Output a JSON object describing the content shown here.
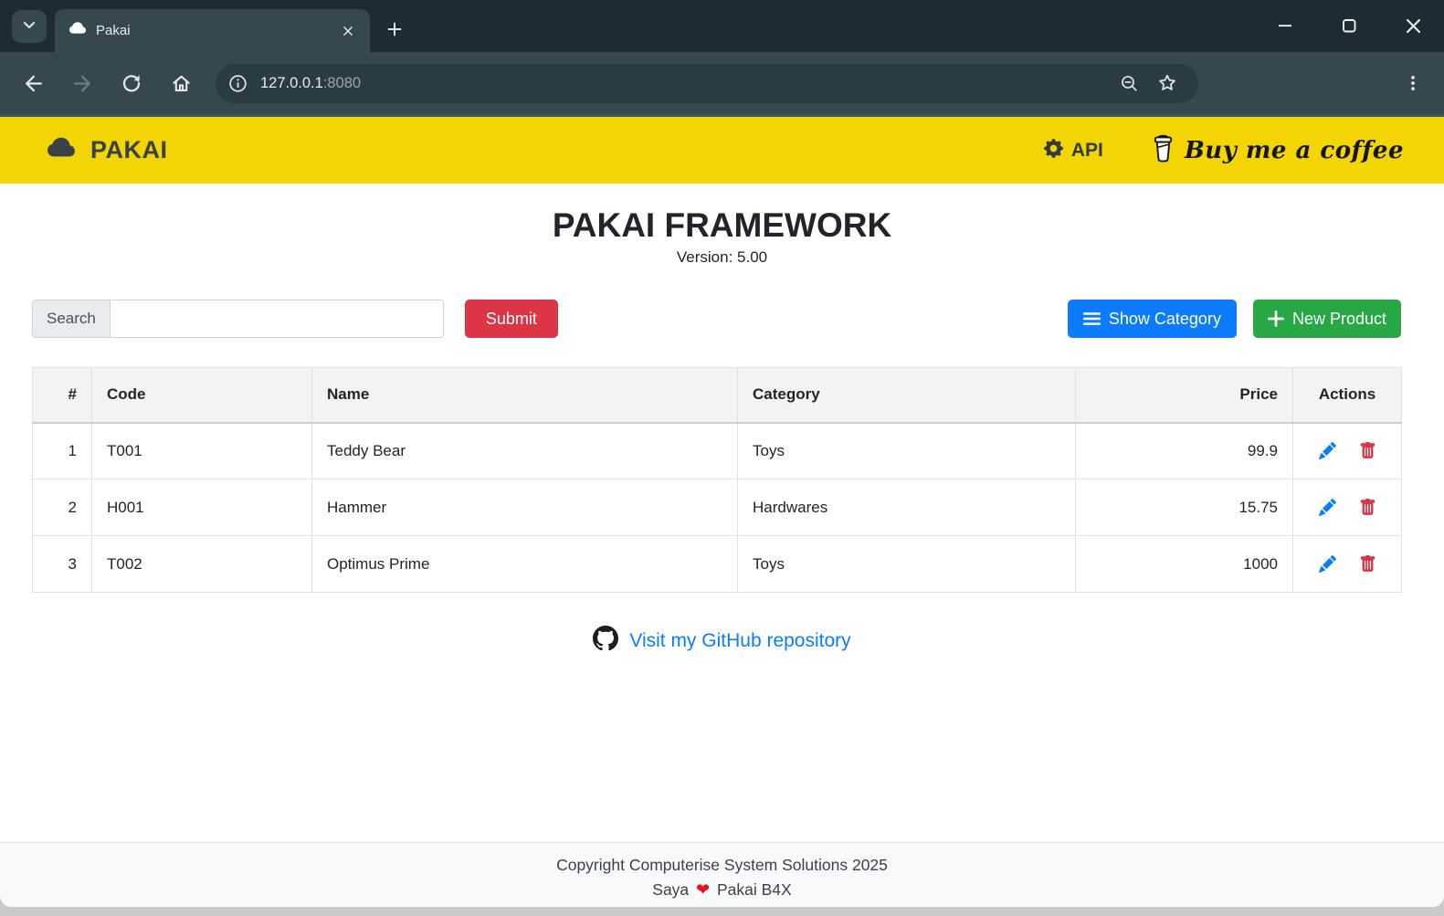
{
  "browser": {
    "tab_title": "Pakai",
    "url_host": "127.0.0.1",
    "url_port": ":8080"
  },
  "navbar": {
    "brand": "PAKAI",
    "api_label": "API",
    "coffee_label": "Buy me a coffee"
  },
  "page": {
    "title": "PAKAI FRAMEWORK",
    "version": "Version: 5.00"
  },
  "search": {
    "label": "Search",
    "value": "",
    "submit_label": "Submit"
  },
  "buttons": {
    "show_category": "Show Category",
    "new_product": "New Product"
  },
  "table": {
    "headers": [
      "#",
      "Code",
      "Name",
      "Category",
      "Price",
      "Actions"
    ],
    "rows": [
      {
        "num": "1",
        "code": "T001",
        "name": "Teddy Bear",
        "category": "Toys",
        "price": "99.9"
      },
      {
        "num": "2",
        "code": "H001",
        "name": "Hammer",
        "category": "Hardwares",
        "price": "15.75"
      },
      {
        "num": "3",
        "code": "T002",
        "name": "Optimus Prime",
        "category": "Toys",
        "price": "1000"
      }
    ]
  },
  "github": {
    "link_label": "Visit my GitHub repository"
  },
  "footer": {
    "line1": "Copyright Computerise System Solutions 2025",
    "line2_prefix": "Saya",
    "heart": "❤",
    "line2_suffix": "Pakai B4X"
  },
  "colors": {
    "navbar_yellow": "#f2d503",
    "danger_red": "#dc3545",
    "primary_blue": "#0d7bfd",
    "success_green": "#28a745",
    "link_blue": "#0d7bfd",
    "heart_red": "#e8111c"
  }
}
